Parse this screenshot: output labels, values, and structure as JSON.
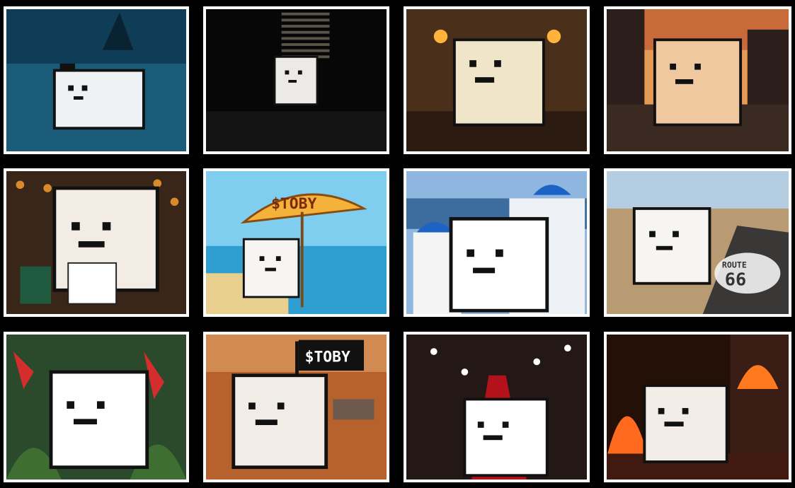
{
  "tiles": [
    {
      "name": "ocean-shark",
      "bg": "#0e3a52"
    },
    {
      "name": "dark-room-blinds",
      "bg": "#0b0b0b"
    },
    {
      "name": "dungeon-torches",
      "bg": "#3a2416"
    },
    {
      "name": "sunset-street",
      "bg": "#3b2a22"
    },
    {
      "name": "casino-cards",
      "bg": "#3a2a1f"
    },
    {
      "name": "beach-umbrella",
      "bg": "#6ec3e6",
      "sign": "$TOBY"
    },
    {
      "name": "santorini",
      "bg": "#6b97c4"
    },
    {
      "name": "route-66",
      "bg": "#9db5c8",
      "sign": "ROUTE 66"
    },
    {
      "name": "jungle-parrots",
      "bg": "#1f3b22"
    },
    {
      "name": "mars-flag",
      "bg": "#b5672e",
      "sign": "$TOBY"
    },
    {
      "name": "red-carpet",
      "bg": "#2a1d1a"
    },
    {
      "name": "burning-building",
      "bg": "#2b120a"
    }
  ],
  "colors": {
    "frame": "#ffffff",
    "dog": "#f4f1ec",
    "outline": "#111111"
  }
}
